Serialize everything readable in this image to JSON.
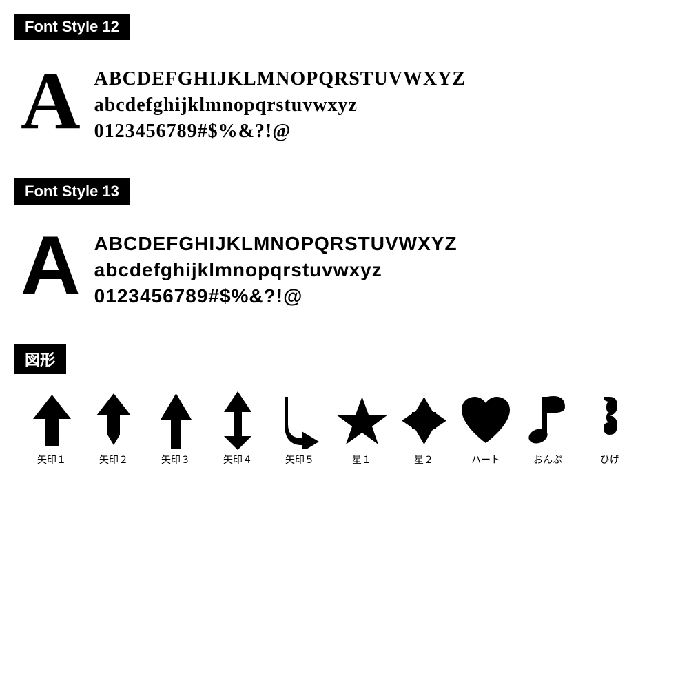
{
  "sections": [
    {
      "id": "font-style-12",
      "header": "Font Style 12",
      "big_letter": "A",
      "lines": [
        "ABCDEFGHIJKLMNOPQRSTUVWXYZ",
        "abcdefghijklmnopqrstuvwxyz",
        "0123456789#$%&?!@"
      ],
      "font_type": "serif"
    },
    {
      "id": "font-style-13",
      "header": "Font Style 13",
      "big_letter": "A",
      "lines": [
        "ABCDEFGHIJKLMNOPQRSTUVWXYZ",
        "abcdefghijklmnopqrstuvwxyz",
        "0123456789#$%&?!@"
      ],
      "font_type": "sans-serif"
    }
  ],
  "shapes_section": {
    "header": "図形",
    "shapes": [
      {
        "id": "arrow1",
        "label": "矢印１"
      },
      {
        "id": "arrow2",
        "label": "矢印２"
      },
      {
        "id": "arrow3",
        "label": "矢印３"
      },
      {
        "id": "arrow4",
        "label": "矢印４"
      },
      {
        "id": "arrow5",
        "label": "矢印５"
      },
      {
        "id": "star1",
        "label": "星１"
      },
      {
        "id": "star2",
        "label": "星２"
      },
      {
        "id": "heart",
        "label": "ハート"
      },
      {
        "id": "note",
        "label": "おんぷ"
      },
      {
        "id": "mustache",
        "label": "ひげ"
      }
    ]
  }
}
